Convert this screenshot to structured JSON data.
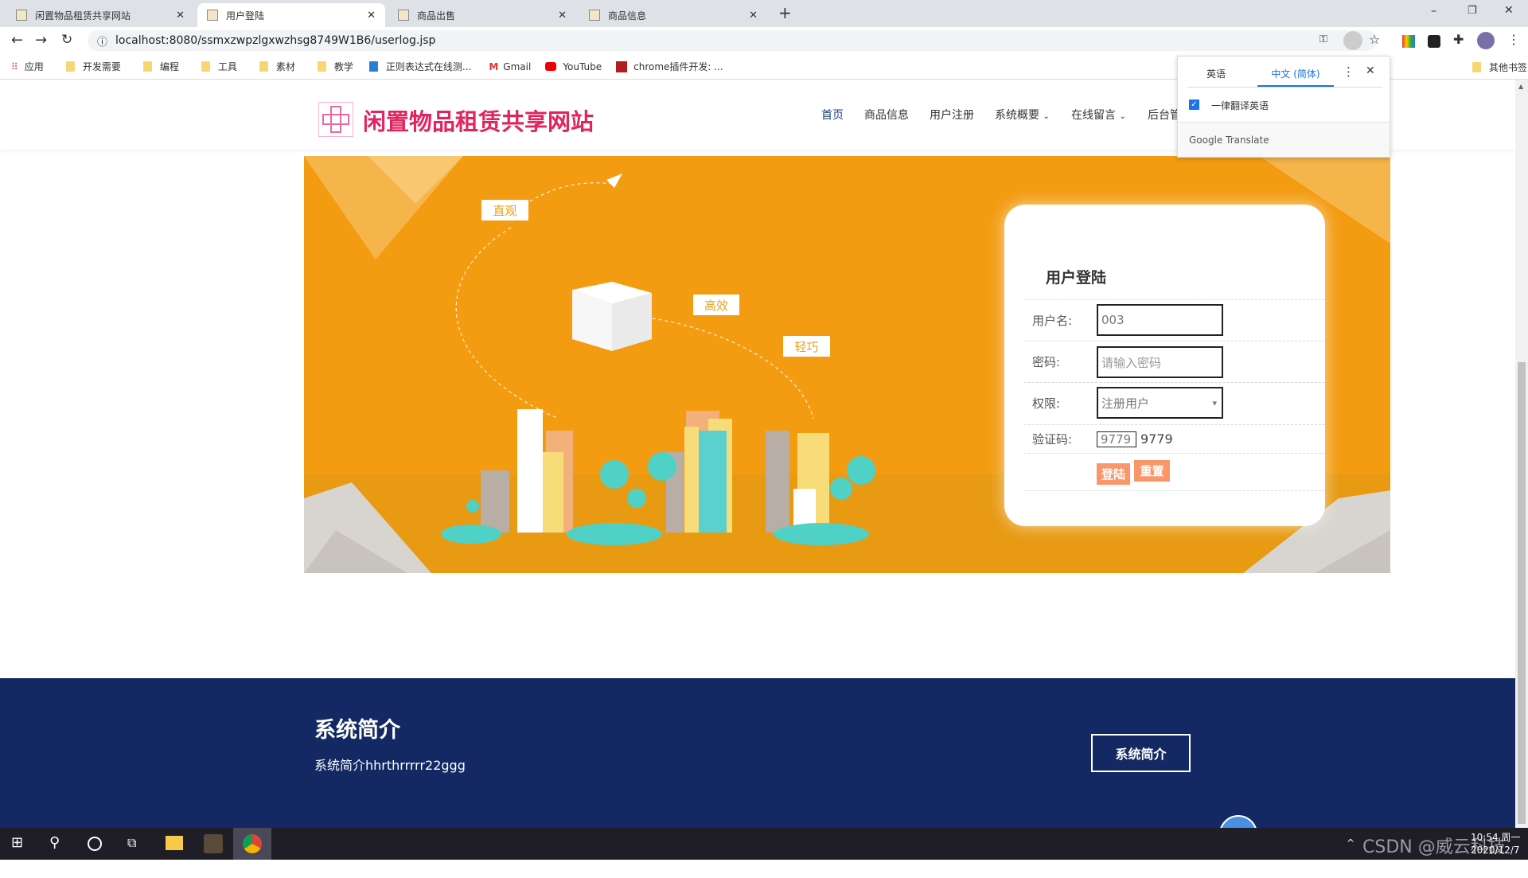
{
  "browser": {
    "tabs": [
      {
        "title": "闲置物品租赁共享网站"
      },
      {
        "title": "用户登陆",
        "active": true
      },
      {
        "title": "商品出售"
      },
      {
        "title": "商品信息"
      }
    ],
    "new_tab": "+",
    "url": "localhost:8080/ssmxzwpzlgxwzhsg8749W1B6/userlog.jsp",
    "bookmarks": [
      "应用",
      "开发需要",
      "编程",
      "工具",
      "素材",
      "教学",
      "正则表达式在线测...",
      "Gmail",
      "YouTube",
      "chrome插件开发: ..."
    ],
    "other_bookmarks": "其他书签"
  },
  "translate_popup": {
    "tab_source": "英语",
    "tab_target": "中文 (简体)",
    "checkbox_label": "一律翻译英语",
    "checked": true,
    "footer": "Google Translate"
  },
  "site": {
    "title": "闲置物品租赁共享网站",
    "brand_color": "#e0245e",
    "nav": [
      {
        "label": "首页",
        "active": true
      },
      {
        "label": "商品信息"
      },
      {
        "label": "用户注册"
      },
      {
        "label": "系统概要",
        "dropdown": true
      },
      {
        "label": "在线留言",
        "dropdown": true
      },
      {
        "label": "后台管"
      }
    ]
  },
  "banner": {
    "bubbles": [
      "直观",
      "高效",
      "轻巧"
    ],
    "color": "#f39c12"
  },
  "login": {
    "title": "用户登陆",
    "username_label": "用户名:",
    "username_value": "003",
    "password_label": "密码:",
    "password_placeholder": "请输入密码",
    "role_label": "权限:",
    "role_value": "注册用户",
    "captcha_label": "验证码:",
    "captcha_input": "9779",
    "captcha_code": "9779",
    "login_button": "登陆",
    "reset_button": "重置"
  },
  "footer": {
    "title": "系统简介",
    "text": "系统简介hhrthrrrrr22ggg",
    "button": "系统简介"
  },
  "taskbar": {
    "time": "10:54 周一",
    "date": "2020/12/7",
    "watermark": "CSDN @威云科技2010"
  }
}
